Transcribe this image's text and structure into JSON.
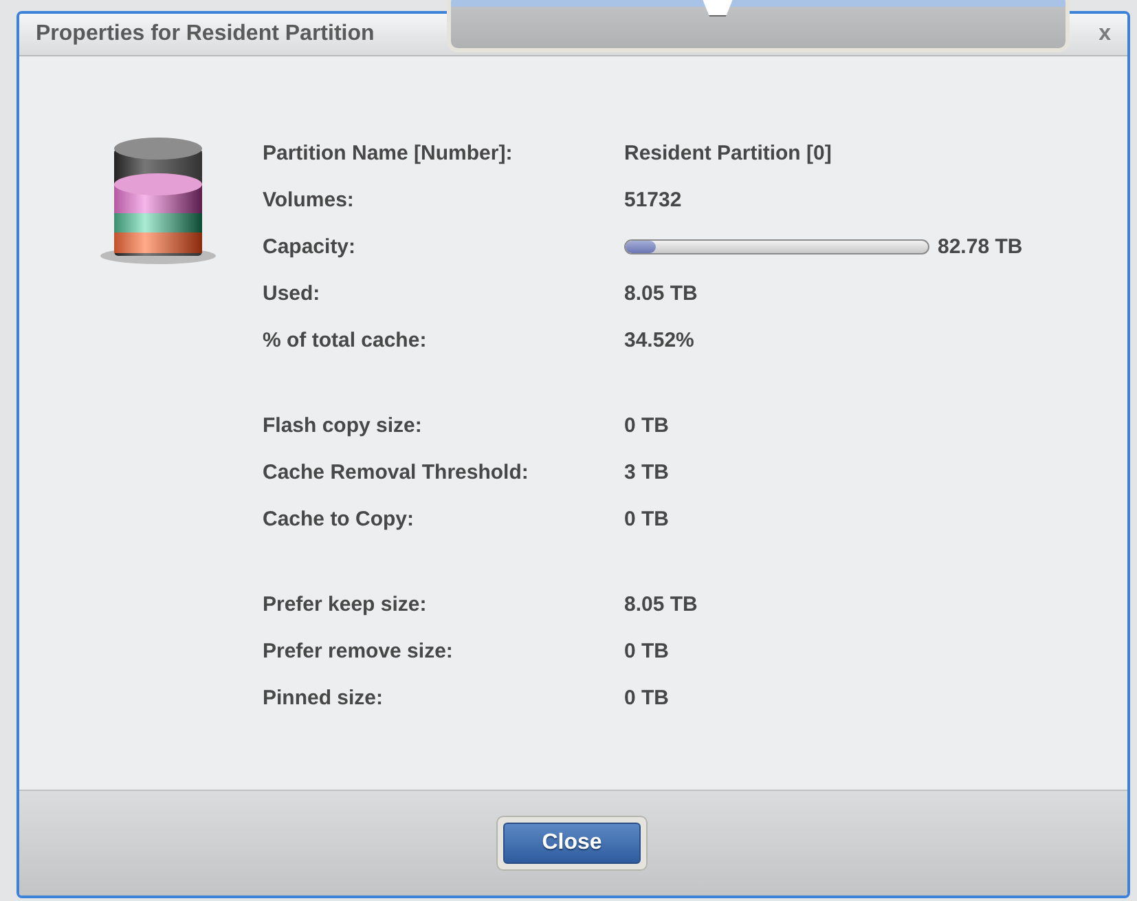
{
  "dialog": {
    "title": "Properties for Resident Partition",
    "close_icon": "x"
  },
  "groups": [
    {
      "rows": [
        {
          "kind": "text",
          "label": "Partition Name [Number]:",
          "value": "Resident Partition [0]"
        },
        {
          "kind": "text",
          "label": "Volumes:",
          "value": "51732"
        },
        {
          "kind": "bar",
          "label": "Capacity:",
          "value": "82.78 TB",
          "level": 0.1
        },
        {
          "kind": "text",
          "label": "Used:",
          "value": "8.05 TB"
        },
        {
          "kind": "text",
          "label": "% of total cache:",
          "value": "34.52%"
        }
      ]
    },
    {
      "rows": [
        {
          "kind": "text",
          "label": "Flash copy size:",
          "value": "0 TB"
        },
        {
          "kind": "text",
          "label": "Cache Removal Threshold:",
          "value": "3 TB"
        },
        {
          "kind": "text",
          "label": "Cache to Copy:",
          "value": "0 TB"
        }
      ]
    },
    {
      "rows": [
        {
          "kind": "text",
          "label": "Prefer keep size:",
          "value": "8.05 TB"
        },
        {
          "kind": "text",
          "label": "Prefer remove size:",
          "value": "0 TB"
        },
        {
          "kind": "text",
          "label": "Pinned size:",
          "value": "0 TB"
        }
      ]
    }
  ],
  "buttons": [
    {
      "label": "Close"
    }
  ]
}
